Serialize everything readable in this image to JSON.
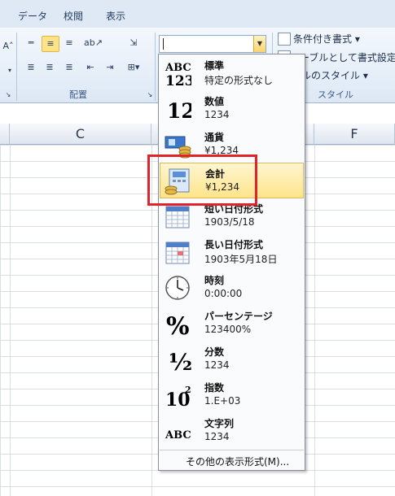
{
  "ribbon": {
    "tabs": [
      "データ",
      "校閲",
      "表示"
    ],
    "group_alignment_label": "配置",
    "group_style_label": "スタイル",
    "conditional_format": "条件付き書式 ▾",
    "format_as_table": "テーブルとして書式設定 ▾",
    "cell_styles": "ルのスタイル ▾",
    "format_combo_value": ""
  },
  "sheet": {
    "columns": [
      "C",
      "F"
    ]
  },
  "number_format_menu": {
    "items": [
      {
        "title": "標準",
        "example": "特定の形式なし",
        "icon": "abc-123-icon"
      },
      {
        "title": "数値",
        "example": "1234",
        "icon": "number-12-icon"
      },
      {
        "title": "通貨",
        "example": "¥1,234",
        "icon": "currency-icon"
      },
      {
        "title": "会計",
        "example": "¥1,234",
        "icon": "accounting-icon"
      },
      {
        "title": "短い日付形式",
        "example": "1903/5/18",
        "icon": "calendar-icon"
      },
      {
        "title": "長い日付形式",
        "example": "1903年5月18日",
        "icon": "calendar-icon"
      },
      {
        "title": "時刻",
        "example": "0:00:00",
        "icon": "clock-icon"
      },
      {
        "title": "パーセンテージ",
        "example": "123400%",
        "icon": "percent-icon"
      },
      {
        "title": "分数",
        "example": "1234",
        "icon": "fraction-icon"
      },
      {
        "title": "指数",
        "example": "1.E+03",
        "icon": "exponent-icon"
      },
      {
        "title": "文字列",
        "example": "1234",
        "icon": "abc-text-icon"
      }
    ],
    "more_formats": "その他の表示形式(M)..."
  },
  "colors": {
    "selection_fill": "#fde48b",
    "annotation_border": "#e0242a"
  }
}
